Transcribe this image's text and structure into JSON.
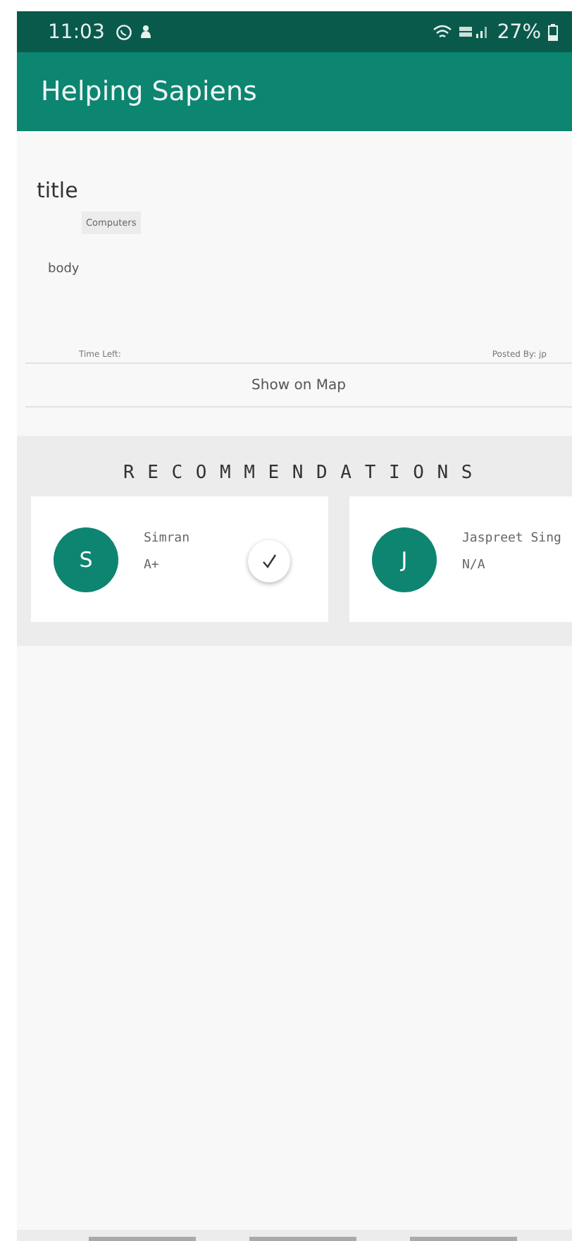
{
  "status_bar": {
    "time": "11:03",
    "battery": "27%"
  },
  "app_bar": {
    "title": "Helping Sapiens"
  },
  "post": {
    "title": "title",
    "category": "Computers",
    "body": "body",
    "time_left": "Time Left:",
    "posted_by": "Posted By: jp",
    "map_button": "Show on Map"
  },
  "recommendations": {
    "heading": "RECOMMENDATIONS",
    "people": [
      {
        "initial": "S",
        "name": "Simran",
        "grade": "A+",
        "checked": true
      },
      {
        "initial": "J",
        "name": "Jaspreet Sing",
        "grade": "N/A",
        "checked": false
      }
    ]
  }
}
